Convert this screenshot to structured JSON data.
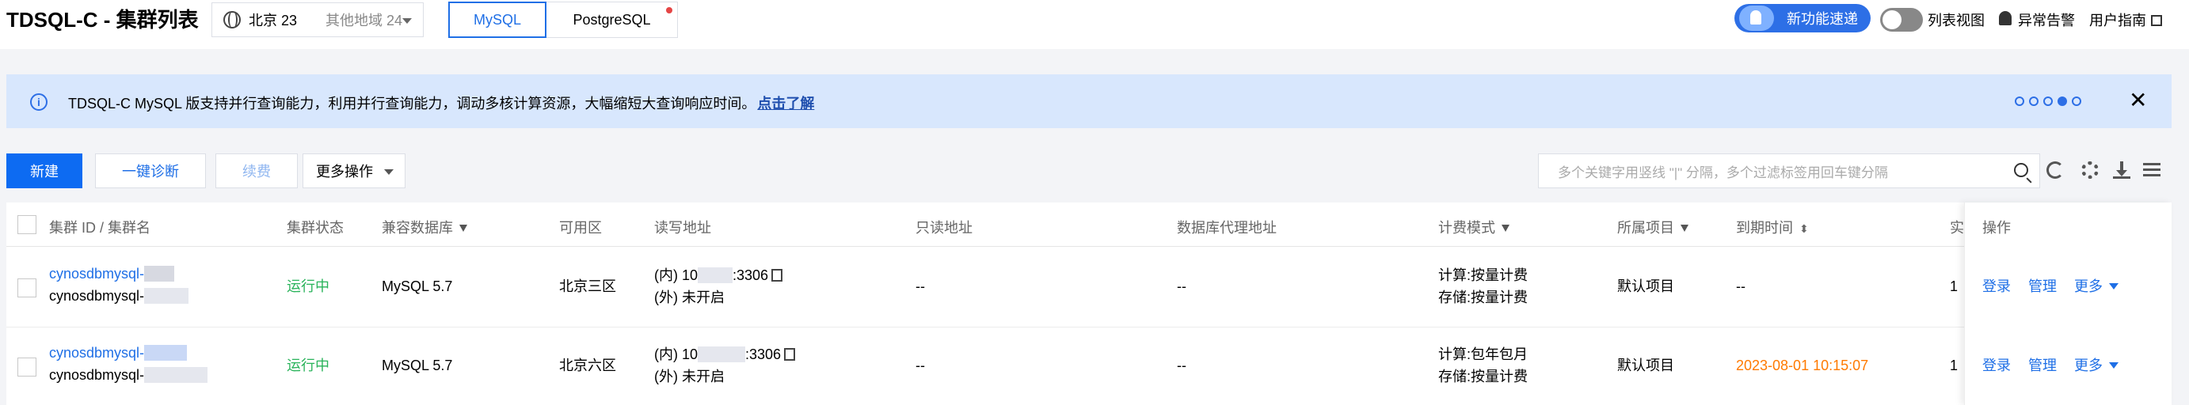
{
  "app": {
    "title": "TDSQL-C - 集群列表"
  },
  "region": {
    "current": "北京 23",
    "other": "其他地域 24"
  },
  "db_tabs": [
    {
      "label": "MySQL",
      "active": true
    },
    {
      "label": "PostgreSQL",
      "active": false,
      "has_dot": true
    }
  ],
  "topright": {
    "new_features": "新功能速递",
    "list_view": "列表视图",
    "alerts": "异常告警",
    "guide": "用户指南"
  },
  "banner": {
    "text": "TDSQL-C MySQL 版支持并行查询能力，利用并行查询能力，调动多核计算资源，大幅缩短大查询响应时间。",
    "link": "点击了解",
    "close": "✕",
    "dots_total": 5,
    "dots_active_index": 3
  },
  "toolbar": {
    "create": "新建",
    "diagnose": "一键诊断",
    "renew": "续费",
    "more_ops": "更多操作",
    "search_placeholder": "多个关键字用竖线 \"|\" 分隔，多个过滤标签用回车键分隔"
  },
  "table": {
    "headers": {
      "id_name": "集群 ID / 集群名",
      "status": "集群状态",
      "compat_db": "兼容数据库",
      "zone": "可用区",
      "rw_addr": "读写地址",
      "ro_addr": "只读地址",
      "proxy_addr": "数据库代理地址",
      "billing": "计费模式",
      "project": "所属项目",
      "expire": "到期时间",
      "cut": "实",
      "ops": "操作"
    },
    "rows": [
      {
        "id": "cynosdbmysql-",
        "name": "cynosdbmysql-",
        "status": "运行中",
        "compat_db": "MySQL 5.7",
        "zone": "北京三区",
        "rw_inner_prefix": "(内) 10",
        "rw_inner_port": ":3306",
        "rw_outer": "(外) 未开启",
        "ro_addr": "--",
        "proxy_addr": "--",
        "billing_compute": "计算:按量计费",
        "billing_storage": "存储:按量计费",
        "project": "默认项目",
        "expire": "--",
        "cut": "1"
      },
      {
        "id": "cynosdbmysql-",
        "name": "cynosdbmysql-",
        "status": "运行中",
        "compat_db": "MySQL 5.7",
        "zone": "北京六区",
        "rw_inner_prefix": "(内) 10",
        "rw_inner_port": ":3306",
        "rw_outer": "(外) 未开启",
        "ro_addr": "--",
        "proxy_addr": "--",
        "billing_compute": "计算:包年包月",
        "billing_storage": "存储:按量计费",
        "project": "默认项目",
        "expire": "2023-08-01 10:15:07",
        "cut": "1"
      }
    ],
    "row_ops": {
      "login": "登录",
      "manage": "管理",
      "more": "更多"
    }
  },
  "colors": {
    "accent": "#0d6bf2",
    "running": "#29b35a",
    "expire_warn": "#ff7a00",
    "banner_bg": "#d8e7fd"
  },
  "icons": [
    "globe-icon",
    "rocket-icon",
    "bell-icon",
    "external-link-icon",
    "info-icon",
    "close-icon",
    "search-icon",
    "refresh-icon",
    "gear-icon",
    "download-icon",
    "columns-icon",
    "copy-icon",
    "filter-icon",
    "sort-icon"
  ]
}
